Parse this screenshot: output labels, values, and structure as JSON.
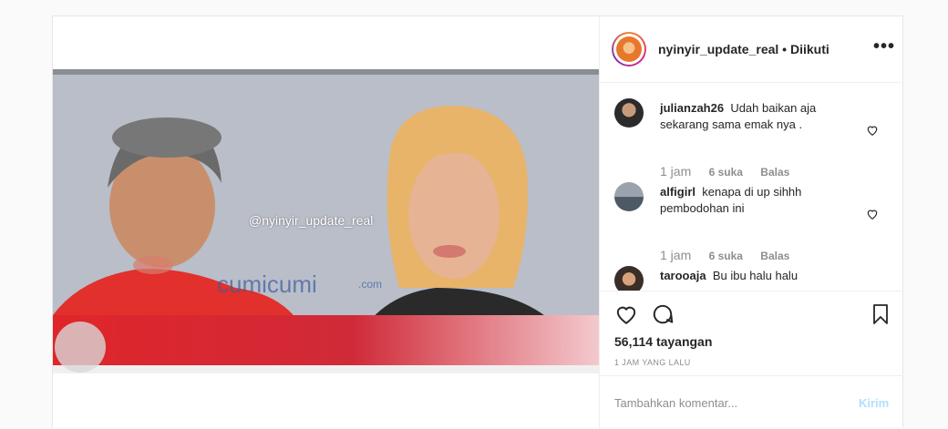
{
  "post": {
    "watermark": "@nyinyir_update_real",
    "header": {
      "username": "nyinyir_update_real",
      "separator": " • ",
      "follow_state": "Diikuti",
      "more": "•••"
    },
    "comments": [
      {
        "user": "julianzah26",
        "text": "Udah baikan aja sekarang sama emak nya .",
        "time": "1 jam",
        "likes": "6 suka",
        "reply": "Balas"
      },
      {
        "user": "alfigirl",
        "text": "kenapa di up sihhh pembodohan ini",
        "time": "1 jam",
        "likes": "6 suka",
        "reply": "Balas"
      },
      {
        "user": "tarooaja",
        "text": "Bu ibu halu halu"
      }
    ],
    "views": "56,114 tayangan",
    "posted_ago": "1 JAM YANG LALU",
    "comment_input": {
      "placeholder": "Tambahkan komentar..."
    },
    "send_label": "Kirim"
  },
  "icons": {
    "like": "heart-icon",
    "comment": "comment-icon",
    "save": "bookmark-icon",
    "options": "more-options-icon"
  },
  "colors": {
    "send_disabled": "#b2dffc",
    "muted": "#8e8e8e",
    "text": "#262626"
  }
}
